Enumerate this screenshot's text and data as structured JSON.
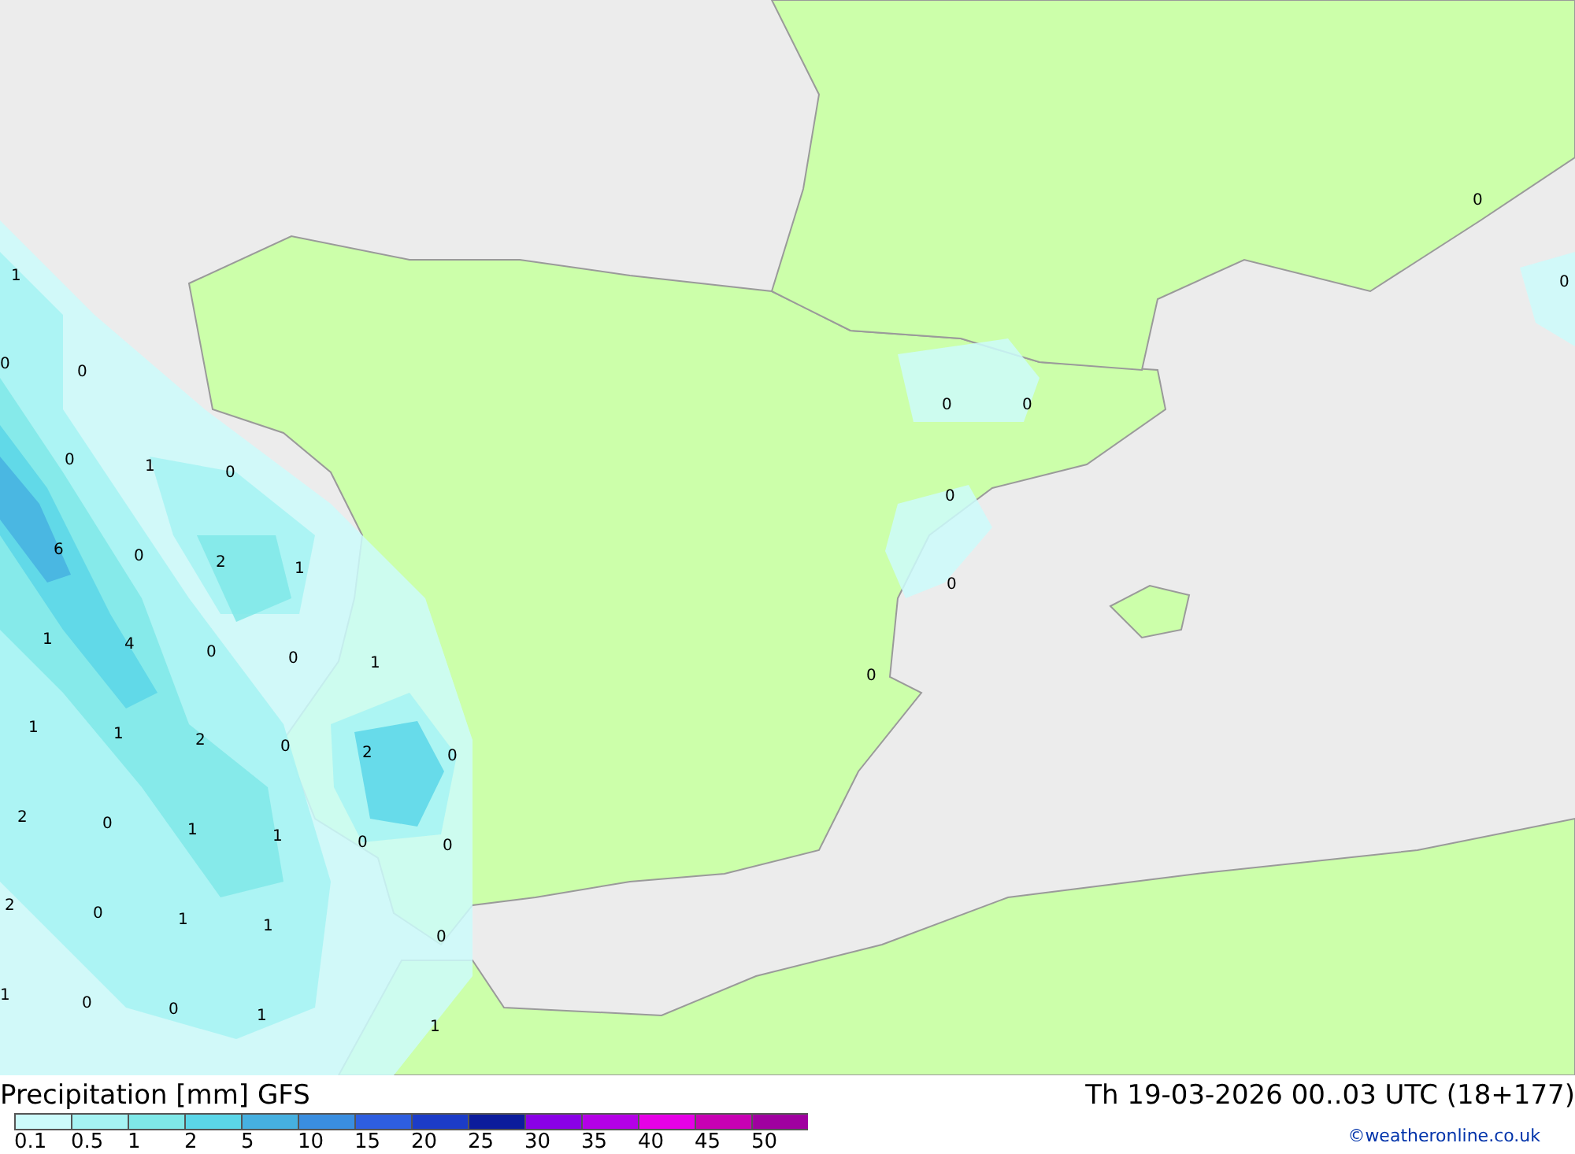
{
  "map": {
    "values": [
      "1",
      "0",
      "0",
      "0",
      "1",
      "0",
      "6",
      "0",
      "2",
      "1",
      "1",
      "4",
      "0",
      "0",
      "1",
      "1",
      "1",
      "2",
      "0",
      "2",
      "0",
      "2",
      "0",
      "1",
      "1",
      "0",
      "0",
      "2",
      "0",
      "1",
      "1",
      "0",
      "1",
      "0",
      "0",
      "1",
      "1",
      "0",
      "0",
      "0",
      "0",
      "0",
      "0",
      "0"
    ]
  },
  "legend": {
    "title": "Precipitation [mm]",
    "model": "GFS",
    "valid_time": "Th 19-03-2026 00..03 UTC (18+177)",
    "scale": [
      {
        "label": "0.1",
        "color": "#ccfbfb"
      },
      {
        "label": "0.5",
        "color": "#a6f3f3"
      },
      {
        "label": "1",
        "color": "#7fe8e8"
      },
      {
        "label": "2",
        "color": "#5bd6e8"
      },
      {
        "label": "5",
        "color": "#46b0e0"
      },
      {
        "label": "10",
        "color": "#3a8ee0"
      },
      {
        "label": "15",
        "color": "#2e5ee0"
      },
      {
        "label": "20",
        "color": "#1c3cc8"
      },
      {
        "label": "25",
        "color": "#0c1c9c"
      },
      {
        "label": "30",
        "color": "#8a00e6"
      },
      {
        "label": "35",
        "color": "#b400e6"
      },
      {
        "label": "40",
        "color": "#e600e6"
      },
      {
        "label": "45",
        "color": "#c800b4"
      },
      {
        "label": "50",
        "color": "#a000a0"
      }
    ],
    "credit": "©weatheronline.co.uk"
  }
}
